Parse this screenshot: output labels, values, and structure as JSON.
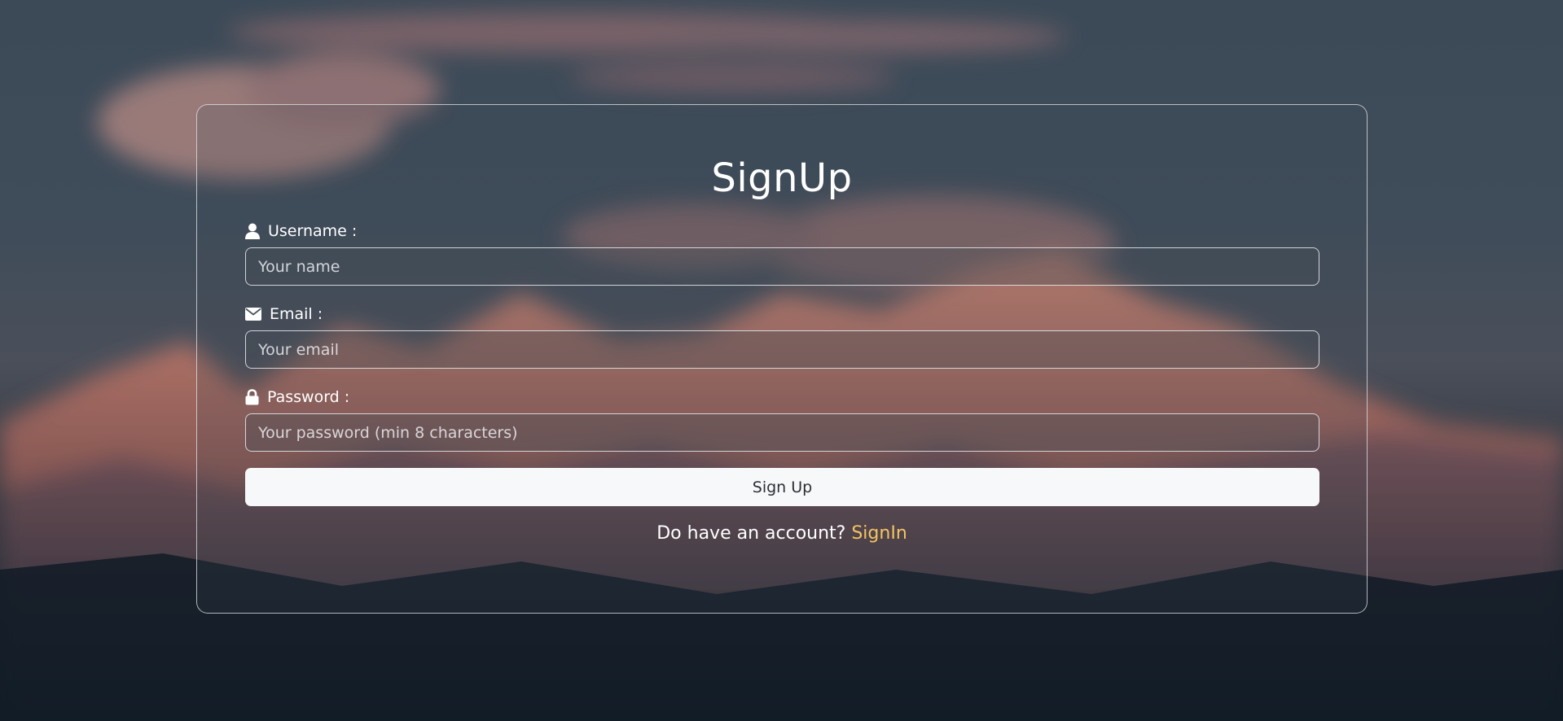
{
  "form": {
    "title": "SignUp",
    "username": {
      "label": "Username :",
      "placeholder": "Your name",
      "icon": "user-icon"
    },
    "email": {
      "label": "Email :",
      "placeholder": "Your email",
      "icon": "envelope-icon"
    },
    "password": {
      "label": "Password :",
      "placeholder": "Your password (min 8 characters)",
      "icon": "lock-icon"
    },
    "submit_label": "Sign Up",
    "footer": {
      "prompt": "Do have an account?",
      "link_label": "SignIn"
    }
  },
  "colors": {
    "link": "#f2c462",
    "button_bg": "#f7f8fa",
    "text": "#ffffff"
  }
}
